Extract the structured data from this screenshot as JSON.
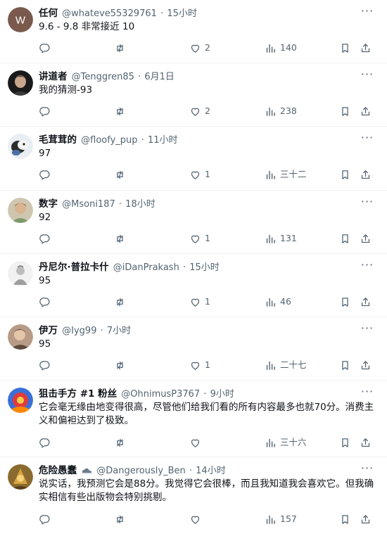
{
  "posts": [
    {
      "name": "任何",
      "handle": "@whateve55329761",
      "dot": "·",
      "time": "15小时",
      "text": "9.6 - 9.8 非常接近 10",
      "likes": "2",
      "views": "140",
      "avatar_letter": "W"
    },
    {
      "name": "讲道者",
      "handle": "@Tenggren85",
      "dot": "·",
      "time": "6月1日",
      "text": "我的猜测-93",
      "likes": "2",
      "views": "238"
    },
    {
      "name": "毛茸茸的",
      "handle": "@floofy_pup",
      "dot": "·",
      "time": "11小时",
      "text": "97",
      "likes": "1",
      "views": "三十二"
    },
    {
      "name": "数字",
      "handle": "@Msoni187",
      "dot": "·",
      "time": "18小时",
      "text": "92",
      "likes": "1",
      "views": "131"
    },
    {
      "name": "丹尼尔·普拉卡什",
      "handle": "@iDanPrakash",
      "dot": "·",
      "time": "15小时",
      "text": "95",
      "likes": "1",
      "views": "46"
    },
    {
      "name": "伊万",
      "handle": "@Iyg99",
      "dot": "·",
      "time": "7小时",
      "text": "95",
      "likes": "1",
      "views": "二十七"
    },
    {
      "name": "狙击手方 #1 粉丝",
      "handle": "@OhnimusP3767",
      "dot": "·",
      "time": "9小时",
      "text": "它会毫无缘由地变得很高，尽管他们给我们看的所有内容最多也就70分。消费主义和偏袒达到了极致。",
      "likes": "",
      "views": "三十六"
    },
    {
      "name": "危险愚蠢",
      "handle": "@Dangerously_Ben",
      "dot": "·",
      "time": "14小时",
      "text": "说实话，我预测它会是88分。我觉得它会很棒，而且我知道我会喜欢它。但我确实相信有些出版物会特别挑剔。",
      "likes": "",
      "views": "157"
    }
  ],
  "icons": {
    "more": "more-icon",
    "reply": "reply-icon",
    "retweet": "retweet-icon",
    "like": "heart-icon",
    "views": "views-icon",
    "bookmark": "bookmark-icon",
    "share": "share-icon"
  },
  "colors": {
    "text_primary": "#0f1419",
    "text_secondary": "#536471",
    "divider": "#eff3f4"
  }
}
